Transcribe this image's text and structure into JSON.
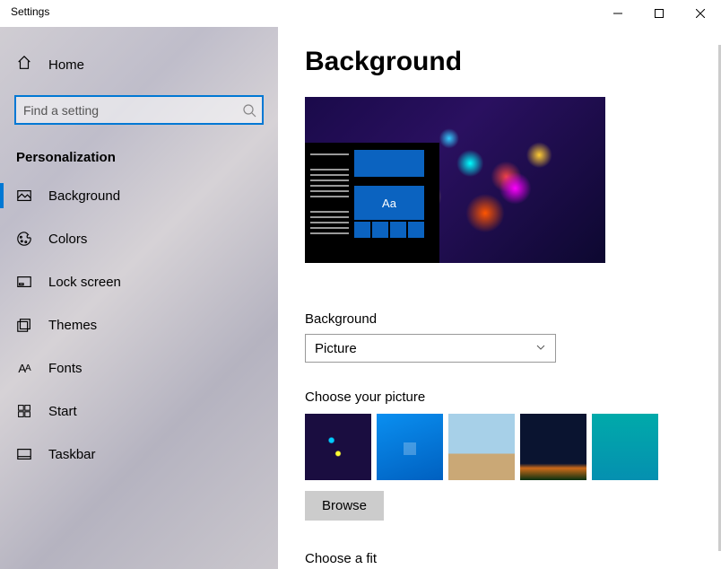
{
  "window": {
    "title": "Settings"
  },
  "sidebar": {
    "home": "Home",
    "search_placeholder": "Find a setting",
    "category": "Personalization",
    "items": [
      {
        "label": "Background",
        "selected": true
      },
      {
        "label": "Colors"
      },
      {
        "label": "Lock screen"
      },
      {
        "label": "Themes"
      },
      {
        "label": "Fonts"
      },
      {
        "label": "Start"
      },
      {
        "label": "Taskbar"
      }
    ]
  },
  "main": {
    "heading": "Background",
    "preview_tile_text": "Aa",
    "bg_label": "Background",
    "bg_dropdown_value": "Picture",
    "choose_picture_label": "Choose your picture",
    "browse_label": "Browse",
    "choose_fit_label": "Choose a fit",
    "thumbnails": [
      "paint-splash",
      "windows-blue",
      "beach-rocks",
      "night-camp",
      "underwater"
    ]
  }
}
